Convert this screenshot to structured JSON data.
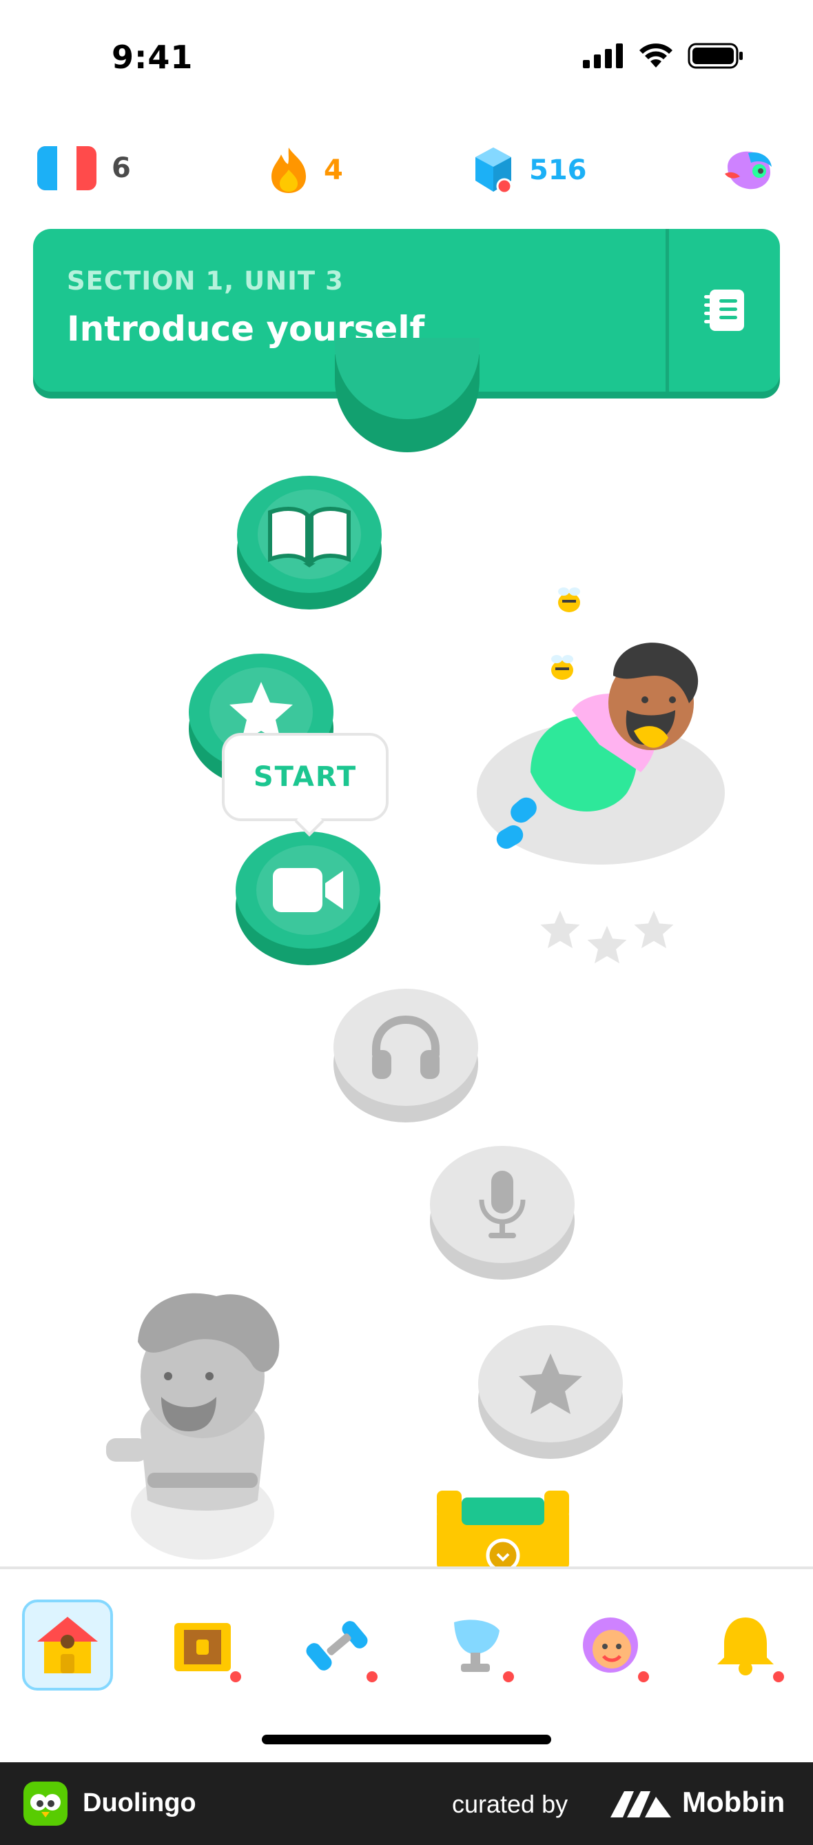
{
  "status_bar": {
    "time": "9:41"
  },
  "stats": {
    "course_flag": "france-flag",
    "course_count": "6",
    "streak": "4",
    "gems": "516"
  },
  "section": {
    "label": "SECTION 1, UNIT 3",
    "title": "Introduce yourself"
  },
  "path": {
    "start_label": "START",
    "nodes": [
      {
        "icon": "book-icon",
        "state": "completed"
      },
      {
        "icon": "star-icon",
        "state": "completed"
      },
      {
        "icon": "video-icon",
        "state": "current"
      },
      {
        "icon": "headphones-icon",
        "state": "locked"
      },
      {
        "icon": "microphone-icon",
        "state": "locked"
      },
      {
        "icon": "star-icon",
        "state": "locked"
      }
    ]
  },
  "tabs": [
    {
      "name": "home",
      "icon": "house-icon",
      "active": true
    },
    {
      "name": "chests",
      "icon": "treasure-chest-icon",
      "badge": true
    },
    {
      "name": "practice",
      "icon": "dumbbell-icon",
      "badge": true
    },
    {
      "name": "leagues",
      "icon": "trophy-icon",
      "badge": true
    },
    {
      "name": "profile",
      "icon": "avatar-icon",
      "badge": true
    },
    {
      "name": "notifications",
      "icon": "bell-icon",
      "badge": true
    }
  ],
  "footer": {
    "app_name": "Duolingo",
    "curated_by": "curated by",
    "brand": "Mobbin"
  },
  "colors": {
    "primary_green": "#1cc690",
    "streak_orange": "#ff9600",
    "gem_blue": "#1cb0f6",
    "locked_gray": "#e6e6e6"
  }
}
